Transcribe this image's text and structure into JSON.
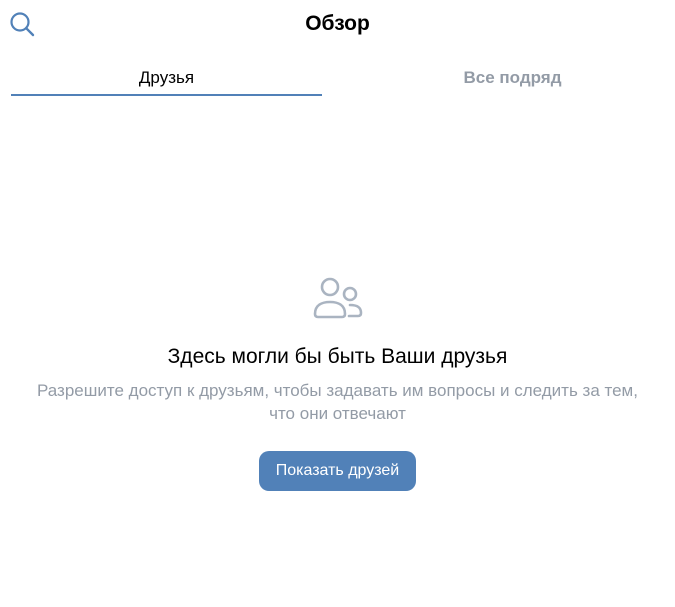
{
  "header": {
    "title": "Обзор",
    "search_icon": "search-icon"
  },
  "tabs": [
    {
      "label": "Друзья",
      "active": true
    },
    {
      "label": "Все подряд",
      "active": false
    }
  ],
  "empty_state": {
    "icon": "friends-icon",
    "title": "Здесь могли бы быть Ваши друзья",
    "description": "Разрешите доступ к друзьям, чтобы задавать им вопросы и следить за тем, что они отвечают",
    "button_label": "Показать друзей"
  },
  "colors": {
    "accent": "#5181b8",
    "muted_text": "#939ba6",
    "icon_gray": "#aab4c1"
  }
}
